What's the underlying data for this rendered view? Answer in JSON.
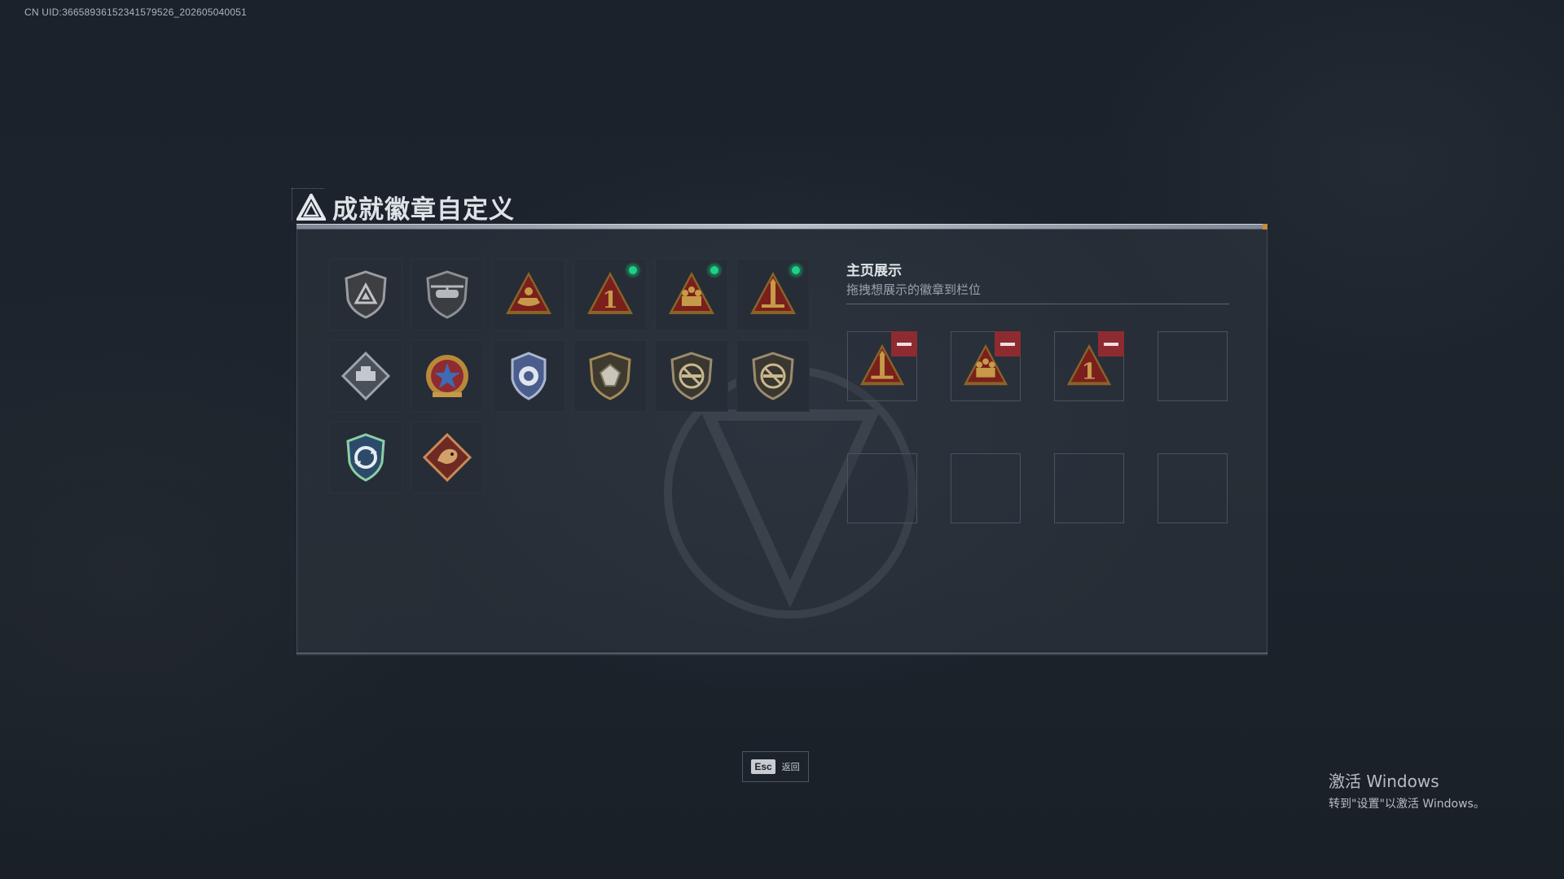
{
  "uid_text": "CN UID:3665893615234157952​6_202605040051",
  "title": "成就徽章自定义",
  "grid": {
    "badges": [
      {
        "icon": "silver-shield-triangle-badge",
        "selected": false
      },
      {
        "icon": "helicopter-shield-badge",
        "selected": false
      },
      {
        "icon": "gold-triangle-boat-badge",
        "selected": false
      },
      {
        "icon": "gold-triangle-number-one-badge",
        "selected": true
      },
      {
        "icon": "gold-triangle-soldiers-badge",
        "selected": true
      },
      {
        "icon": "gold-triangle-rocket-badge",
        "selected": true
      },
      {
        "icon": "diamond-vehicle-badge",
        "selected": false
      },
      {
        "icon": "star-medal-badge",
        "selected": false
      },
      {
        "icon": "blue-police-badge",
        "selected": false
      },
      {
        "icon": "gem-shield-badge",
        "selected": false
      },
      {
        "icon": "no-rifle-shield-badge",
        "selected": false
      },
      {
        "icon": "no-rifle-shield-badge-2",
        "selected": false
      },
      {
        "icon": "green-recycle-shield-badge",
        "selected": false
      },
      {
        "icon": "red-dragon-diamond-badge",
        "selected": false
      }
    ]
  },
  "showcase": {
    "title": "主页展示",
    "subtitle": "拖拽想展示的徽章到栏位",
    "slots": [
      {
        "icon": "gold-triangle-rocket-badge",
        "filled": true
      },
      {
        "icon": "gold-triangle-soldiers-badge",
        "filled": true
      },
      {
        "icon": "gold-triangle-number-one-badge",
        "filled": true
      },
      {
        "icon": "",
        "filled": false
      },
      {
        "icon": "",
        "filled": false
      },
      {
        "icon": "",
        "filled": false
      },
      {
        "icon": "",
        "filled": false
      },
      {
        "icon": "",
        "filled": false
      }
    ]
  },
  "footer": {
    "esc_key": "Esc",
    "esc_label": "返回"
  },
  "activation": {
    "title": "激活 Windows",
    "subtitle": "转到\"设置\"以激活 Windows。"
  },
  "colors": {
    "selected_dot": "#1fd08a",
    "remove_button": "#8e2b31",
    "badge_gold": "#b8893a",
    "badge_red": "#7a1f1c"
  }
}
